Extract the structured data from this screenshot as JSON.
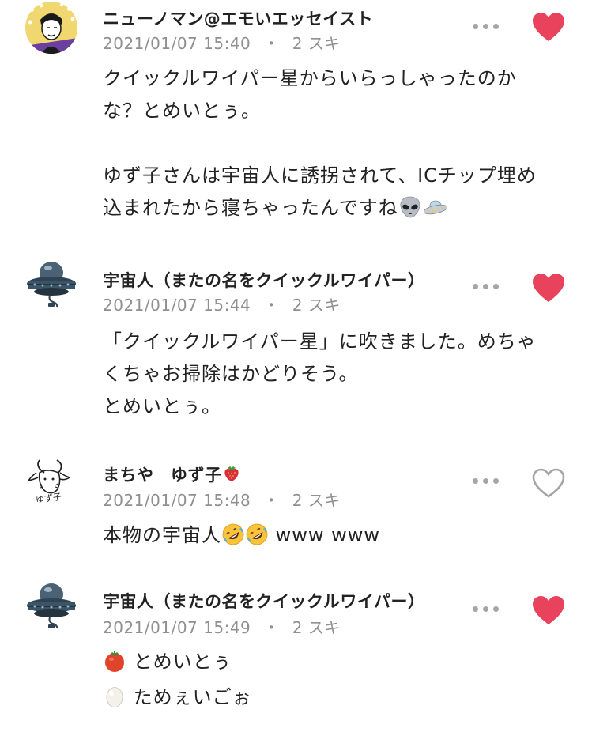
{
  "comments": [
    {
      "username": "ニューノマン@エモいエッセイスト",
      "date": "2021/01/07 15:40",
      "separator": "・",
      "likes": "2 スキ",
      "liked": true,
      "avatar": "illustrated-man-avatar",
      "lines": [
        "クイックルワイパー星からいらっしゃったのか",
        "な？とめいとぅ。",
        "",
        "ゆず子さんは宇宙人に誘拐されて、ICチップ埋め",
        "込まれたから寝ちゃったんですね"
      ],
      "trailing_emoji": [
        "alien-icon",
        "ufo-icon"
      ]
    },
    {
      "username": "宇宙人（またの名をクイックルワイパー）",
      "date": "2021/01/07 15:44",
      "separator": "・",
      "likes": "2 スキ",
      "liked": true,
      "avatar": "ufo-avatar",
      "lines": [
        "「クイックルワイパー星」に吹きました。めちゃ",
        "くちゃお掃除はかどりそう。",
        "とめいとぅ。"
      ]
    },
    {
      "username": "まちや　ゆず子",
      "username_emoji": "strawberry-icon",
      "date": "2021/01/07 15:48",
      "separator": "・",
      "likes": "2 スキ",
      "liked": false,
      "avatar": "goat-sketch-avatar",
      "line_prefix": "本物の宇宙人",
      "line_emoji": [
        "rofl-icon",
        "rofl-icon"
      ],
      "line_suffix": " www www"
    },
    {
      "username": "宇宙人（またの名をクイックルワイパー）",
      "date": "2021/01/07 15:49",
      "separator": "・",
      "likes": "2 スキ",
      "liked": true,
      "avatar": "ufo-avatar",
      "emoji_lines": [
        {
          "emoji": "tomato-icon",
          "text": "とめいとぅ"
        },
        {
          "emoji": "egg-icon",
          "text": "ためぇいごぉ"
        }
      ]
    }
  ],
  "colors": {
    "heart_liked": "#e9425d",
    "heart_outline": "#a5a5a5",
    "meta_text": "#909090",
    "body_text": "#222222"
  }
}
